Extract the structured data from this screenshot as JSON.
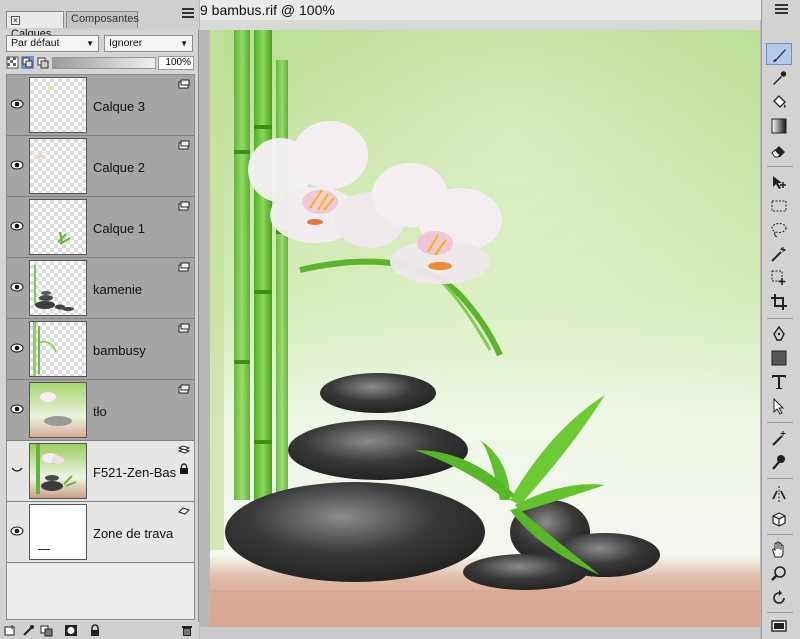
{
  "document": {
    "title": "9 bambus.rif @ 100%"
  },
  "panel": {
    "tabs": [
      {
        "label": "Calques",
        "active": true,
        "closable": true
      },
      {
        "label": "Composantes",
        "active": false
      }
    ],
    "blend_mode": "Par défaut",
    "composite_method": "Ignorer",
    "opacity": "100%",
    "layers": [
      {
        "name": "Calque 3",
        "visible": true,
        "locked": false,
        "selected": true
      },
      {
        "name": "Calque 2",
        "visible": true,
        "locked": false,
        "selected": true
      },
      {
        "name": "Calque 1",
        "visible": true,
        "locked": false,
        "selected": true
      },
      {
        "name": "kamenie",
        "visible": true,
        "locked": false,
        "selected": true
      },
      {
        "name": "bambusy",
        "visible": true,
        "locked": false,
        "selected": true
      },
      {
        "name": "tło",
        "visible": true,
        "locked": false,
        "selected": true
      },
      {
        "name": "F521-Zen-Bas",
        "visible": false,
        "locked": true,
        "selected": false
      },
      {
        "name": "Zone de trava",
        "visible": true,
        "locked": false,
        "selected": false
      }
    ],
    "bottom_icons": [
      "new-layer-icon",
      "layer-effects-icon",
      "group-icon",
      "mask-icon",
      "lock-icon",
      "trash-icon"
    ]
  },
  "toolbar": {
    "tools": [
      "brush-icon",
      "dropper-icon",
      "paint-bucket-icon",
      "gradient-icon",
      "eraser-icon",
      "layer-adjuster-icon",
      "rectangle-select-icon",
      "lasso-icon",
      "magic-wand-icon",
      "transform-icon",
      "crop-icon",
      "pen-icon",
      "shape-icon",
      "text-icon",
      "selection-arrow-icon",
      "cloner-icon",
      "rubber-stamp-icon",
      "mirror-painting-icon",
      "perspective-icon",
      "grabber-icon",
      "magnifier-icon",
      "rotate-page-icon",
      "paper-icon"
    ],
    "active_tool": "brush-icon"
  },
  "colors": {
    "panel_bg": "#d4d4d4",
    "layer_selected_bg": "#a5a5a5",
    "canvas_green": "#b8dd8c",
    "active_tool_bg": "#b7c9e8"
  }
}
